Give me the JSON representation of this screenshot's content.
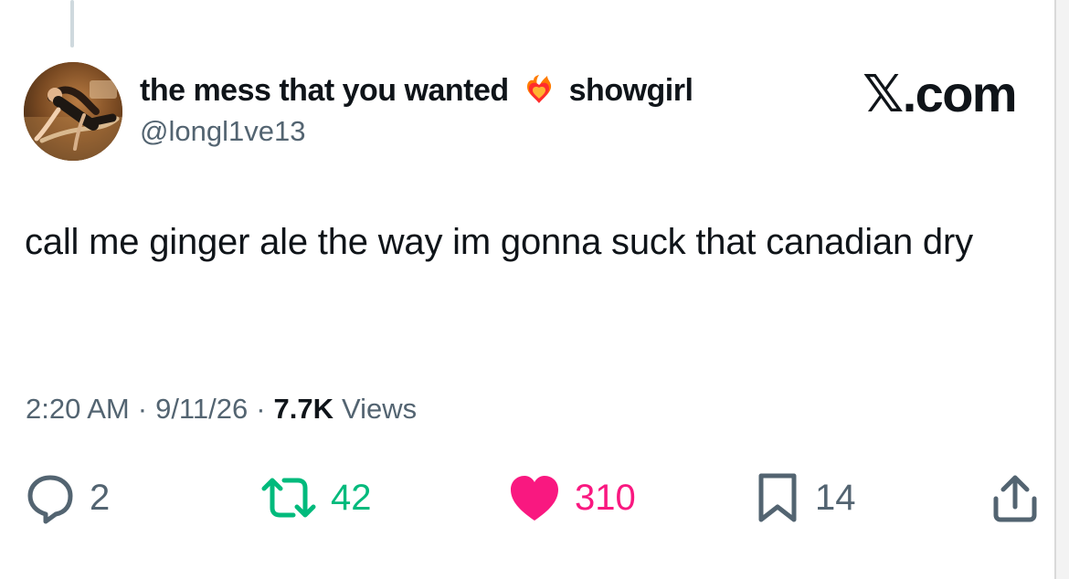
{
  "tweet": {
    "display_name": "the mess that you wanted",
    "display_suffix": "showgirl",
    "handle": "@longl1ve13",
    "brand": "𝕏.com",
    "text": "call me ginger ale the way im gonna suck that canadian dry",
    "time": "2:20 AM",
    "separator": "·",
    "date": "9/11/26",
    "views_count": "7.7K",
    "views_label": "Views"
  },
  "actions": {
    "reply_count": "2",
    "repost_count": "42",
    "like_count": "310",
    "bookmark_count": "14"
  },
  "icons": {
    "reply": "reply-icon",
    "repost": "repost-icon",
    "like": "heart-icon",
    "bookmark": "bookmark-icon",
    "share": "share-icon",
    "emoji": "burning-heart-icon"
  },
  "colors": {
    "text": "#0f1419",
    "secondary": "#536471",
    "repost": "#00ba7c",
    "like": "#f91880"
  }
}
